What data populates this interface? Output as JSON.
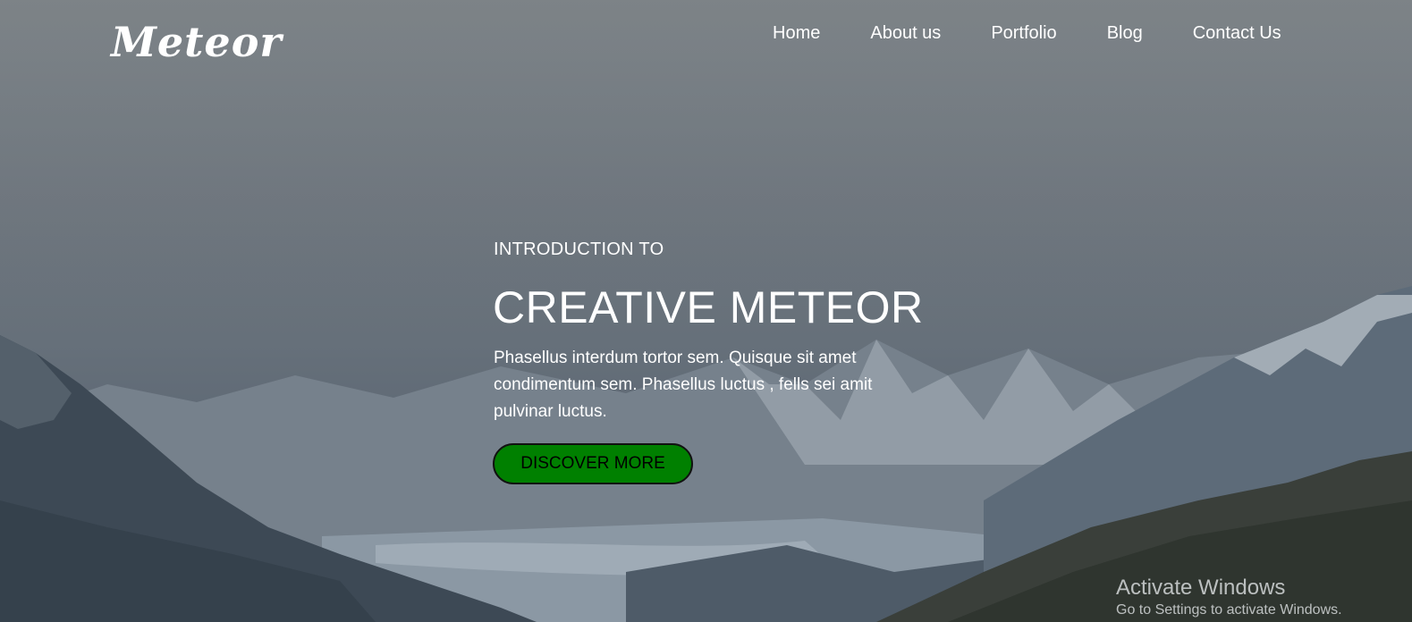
{
  "brand": {
    "logo_text": "Meteor"
  },
  "nav": {
    "items": [
      {
        "label": "Home"
      },
      {
        "label": "About us"
      },
      {
        "label": "Portfolio"
      },
      {
        "label": "Blog"
      },
      {
        "label": "Contact Us"
      }
    ]
  },
  "hero": {
    "intro": "INTRODUCTION TO",
    "title": "CREATIVE METEOR",
    "description": "Phasellus interdum tortor sem. Quisque sit amet condimentum sem. Phasellus luctus , fells sei amit pulvinar luctus.",
    "cta_label": "DISCOVER MORE",
    "background_description": "misty mountain valley"
  },
  "os_watermark": {
    "line1": "Activate Windows",
    "line2": "Go to Settings to activate Windows."
  },
  "colors": {
    "cta_background": "#008000",
    "text": "#ffffff"
  }
}
